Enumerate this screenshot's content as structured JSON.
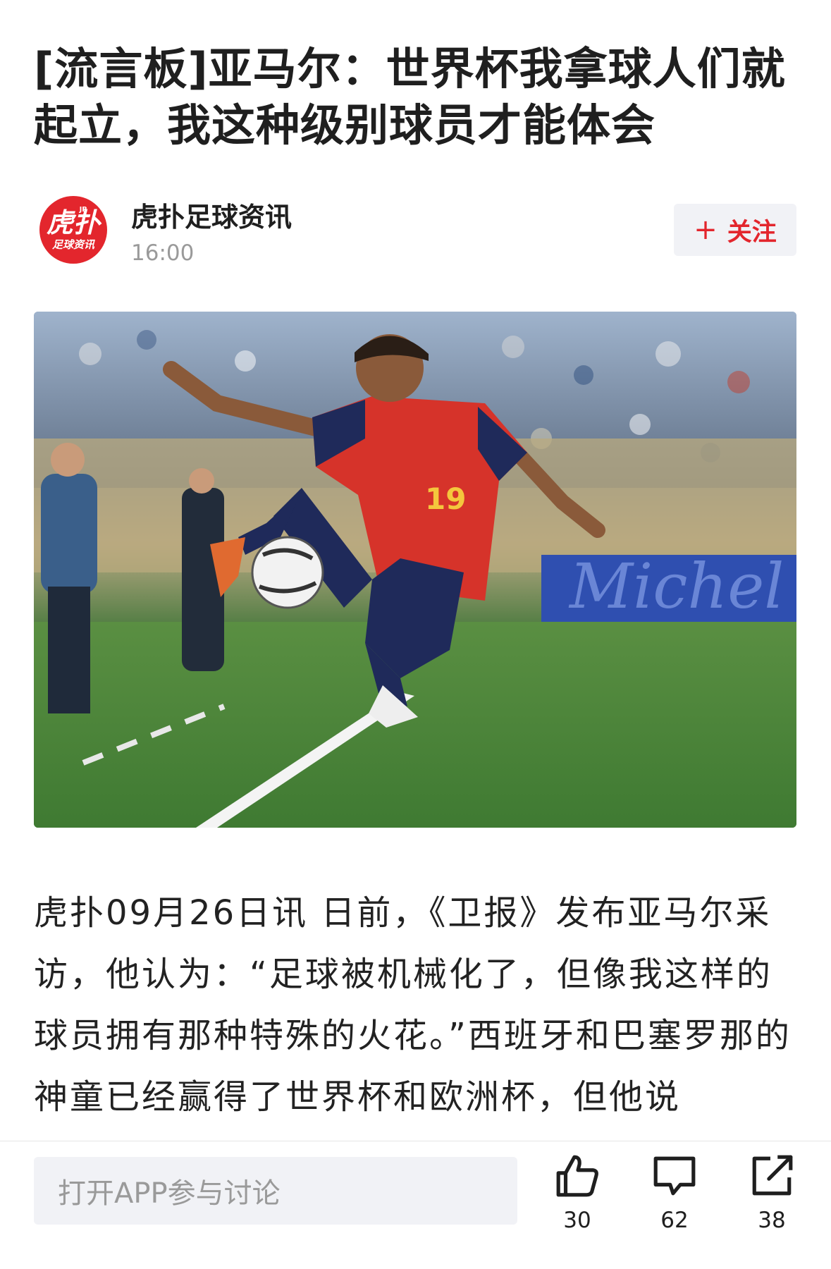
{
  "article": {
    "title": "[流言板]亚马尔：世界杯我拿球人们就起立，我这种级别球员才能体会",
    "body": "虎扑09月26日讯 日前，《卫报》发布亚马尔采访，他认为：“足球被机械化了，但像我这样的球员拥有那种特殊的火花。”西班牙和巴塞罗那的神童已经赢得了世界杯和欧洲杯，但他说"
  },
  "author": {
    "name": "虎扑足球资讯",
    "time": "16:00",
    "avatar_main": "虎扑",
    "avatar_sub": "足球资讯",
    "avatar_tag": "JR"
  },
  "follow": {
    "plus": "+",
    "label": "关注"
  },
  "hero_image": {
    "banner_text": "Michel",
    "jersey_number": "19"
  },
  "bottom_bar": {
    "comment_placeholder": "打开APP参与讨论",
    "like_count": "30",
    "comment_count": "62",
    "share_count": "38"
  },
  "colors": {
    "brand_red": "#e3262d",
    "text_dark": "#1f1f1f",
    "text_gray": "#9a9a9a",
    "input_bg": "#f1f2f6"
  },
  "icons": [
    "thumbs-up-icon",
    "comment-bubble-icon",
    "share-icon"
  ]
}
